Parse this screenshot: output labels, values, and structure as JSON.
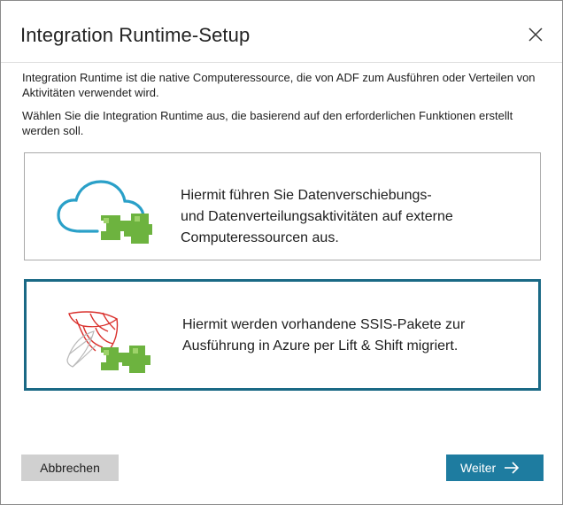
{
  "dialog": {
    "title": "Integration Runtime-Setup",
    "description_1": "Integration Runtime ist die native Computeressource, die von ADF zum Ausführen oder Verteilen von Aktivitäten verwendet wird.",
    "description_2": "Wählen Sie die Integration Runtime aus, die basierend auf den erforderlichen Funktionen erstellt werden soll."
  },
  "options": [
    {
      "icon": "cloud-data-movement-icon",
      "line_1": "Hiermit führen Sie Datenverschiebungs-",
      "line_2": "und Datenverteilungsaktivitäten auf externe",
      "line_3": "Computeressourcen aus.",
      "selected": false
    },
    {
      "icon": "ssis-lift-shift-icon",
      "line_1": "Hiermit werden vorhandene SSIS-Pakete zur",
      "line_2": "Ausführung in Azure per Lift & Shift migriert.",
      "selected": true
    }
  ],
  "footer": {
    "cancel_label": "Abbrechen",
    "next_label": "Weiter"
  },
  "colors": {
    "selected_border": "#1a6985",
    "primary_button": "#1e7ca0",
    "secondary_button": "#d0d0d0",
    "cloud_stroke": "#2aa0c8",
    "connector_green": "#6db33f",
    "ssis_red": "#d9302c"
  }
}
